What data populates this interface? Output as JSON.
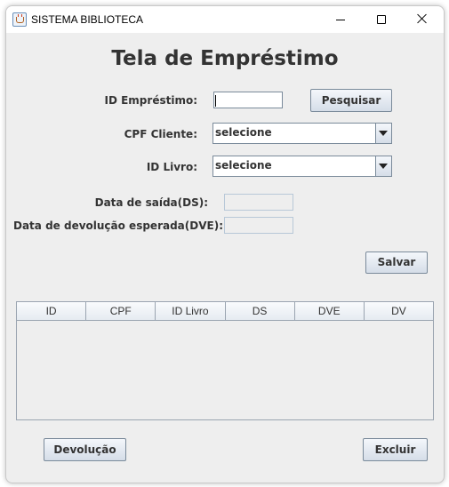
{
  "window": {
    "title": "SISTEMA BIBLIOTECA"
  },
  "screen": {
    "heading": "Tela de Empréstimo"
  },
  "form": {
    "id_emprestimo_label": "ID Empréstimo:",
    "id_emprestimo_value": "",
    "pesquisar_label": "Pesquisar",
    "cpf_cliente_label": "CPF Cliente:",
    "cpf_cliente_selected": "selecione",
    "id_livro_label": "ID Livro:",
    "id_livro_selected": "selecione",
    "data_saida_label": "Data de saída(DS):",
    "data_saida_value": "",
    "data_devolucao_label": "Data de devolução esperada(DVE):",
    "data_devolucao_value": "",
    "salvar_label": "Salvar"
  },
  "table": {
    "columns": [
      "ID",
      "CPF",
      "ID Livro",
      "DS",
      "DVE",
      "DV"
    ],
    "rows": []
  },
  "footer": {
    "devolucao_label": "Devolução",
    "excluir_label": "Excluir"
  }
}
